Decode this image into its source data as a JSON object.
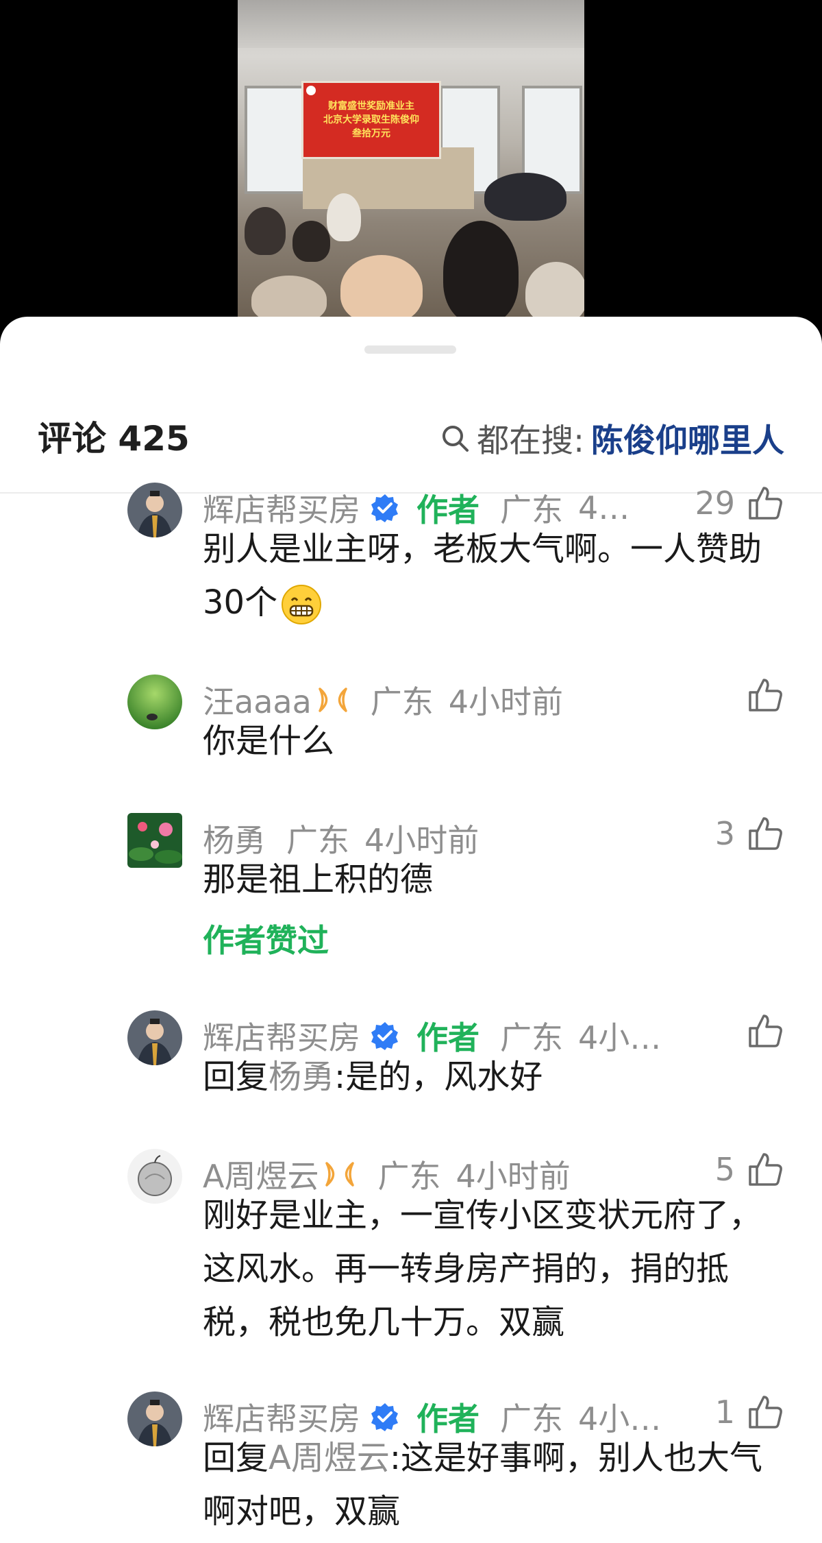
{
  "video": {
    "banner_lines": [
      "财富盛世奖励准业主",
      "北京大学录取生陈俊仰",
      "叁拾万元"
    ]
  },
  "header": {
    "title": "评论 425",
    "search_prefix": "都在搜:",
    "search_query": "陈俊仰哪里人"
  },
  "comments": [
    {
      "name": "辉店帮买房",
      "verified": true,
      "author_tag": "作者",
      "location": "广东",
      "time": "4…",
      "likes": "29",
      "text": "别人是业主呀，老板大气啊。一人赞助30个",
      "emoji": "grin-emoji"
    },
    {
      "name": "汪aaaa",
      "badge": "ribbon-icon",
      "location": "广东",
      "time": "4小时前",
      "likes": "",
      "text": "你是什么"
    },
    {
      "name": "杨勇",
      "location": "广东",
      "time": "4小时前",
      "likes": "3",
      "text": "那是祖上积的德",
      "author_liked": "作者赞过"
    },
    {
      "name": "辉店帮买房",
      "verified": true,
      "author_tag": "作者",
      "location": "广东",
      "time": "4小…",
      "likes": "",
      "reply_prefix": "回复",
      "reply_to": "杨勇",
      "text": ":是的，风水好"
    },
    {
      "name": "A周煜云",
      "badge": "ribbon-icon",
      "location": "广东",
      "time": "4小时前",
      "likes": "5",
      "text": "刚好是业主，一宣传小区变状元府了，这风水。再一转身房产捐的，捐的抵税，税也免几十万。双赢"
    },
    {
      "name": "辉店帮买房",
      "verified": true,
      "author_tag": "作者",
      "location": "广东",
      "time": "4小…",
      "likes": "1",
      "reply_prefix": "回复",
      "reply_to": "A周煜云",
      "text": ":这是好事啊，别人也大气啊对吧，双赢"
    }
  ],
  "colors": {
    "author_green": "#20b25a",
    "search_blue": "#1a3f8a",
    "meta_gray": "#8e8e8e",
    "verified_blue": "#2f7cf6",
    "ribbon_orange": "#f3a53a"
  }
}
